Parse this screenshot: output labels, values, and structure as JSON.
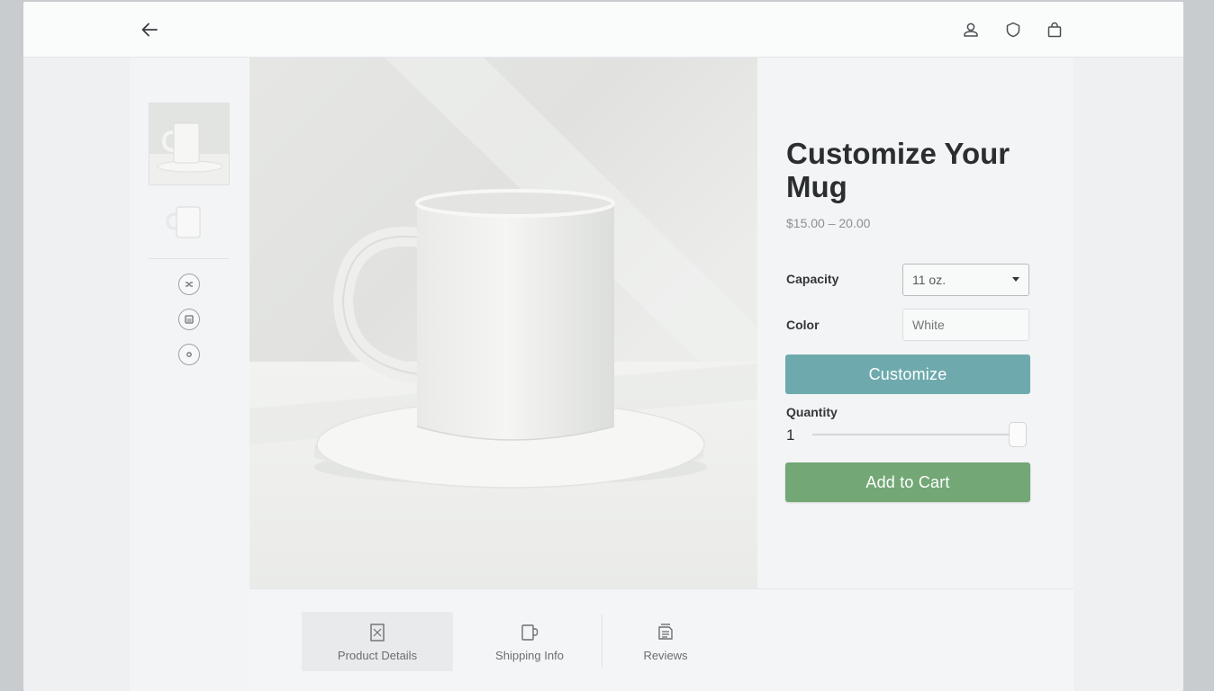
{
  "header": {
    "back_icon": "arrow-left-icon",
    "user_icon": "user-icon",
    "shield_icon": "shield-icon",
    "bag_icon": "shopping-bag-icon"
  },
  "gallery": {
    "thumbnails": [
      "mug-on-coaster",
      "mug-plain"
    ],
    "tools": [
      "shuffle-icon",
      "image-icon",
      "target-icon"
    ]
  },
  "product": {
    "title": "Customize Your Mug",
    "price": "$15.00 – 20.00",
    "capacity_label": "Capacity",
    "capacity_value": "11 oz.",
    "color_label": "Color",
    "color_placeholder": "White",
    "customize_label": "Customize",
    "quantity_label": "Quantity",
    "quantity_value": "1",
    "add_to_cart_label": "Add to Cart"
  },
  "tabs": [
    {
      "label": "Product Details",
      "icon": "document-icon"
    },
    {
      "label": "Shipping Info",
      "icon": "mug-icon"
    },
    {
      "label": "Reviews",
      "icon": "reviews-icon"
    }
  ],
  "colors": {
    "customize_button": "#6eaaad",
    "add_to_cart_button": "#73a775"
  }
}
